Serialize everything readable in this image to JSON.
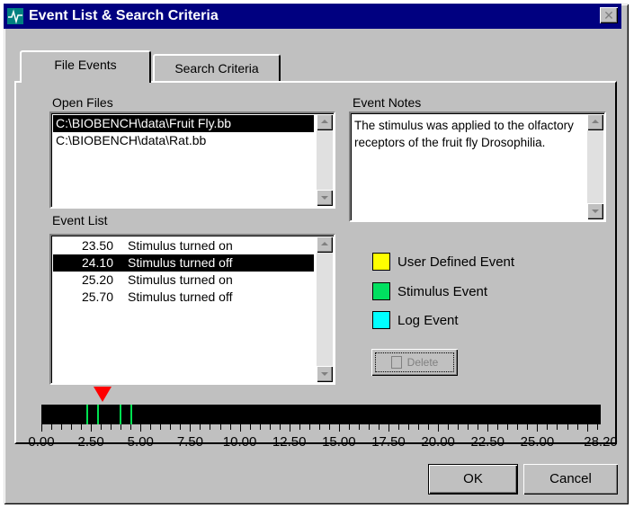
{
  "window": {
    "title": "Event List & Search Criteria"
  },
  "tabs": [
    {
      "label": "File Events",
      "active": true
    },
    {
      "label": "Search Criteria",
      "active": false
    }
  ],
  "open_files": {
    "label": "Open Files",
    "items": [
      "C:\\BIOBENCH\\data\\Fruit Fly.bb",
      "C:\\BIOBENCH\\data\\Rat.bb"
    ],
    "selected_index": 0
  },
  "event_notes": {
    "label": "Event Notes",
    "text": "The stimulus was applied to the olfactory receptors of the fruit fly Drosophilia."
  },
  "event_list": {
    "label": "Event List",
    "items": [
      {
        "time": "23.50",
        "desc": "Stimulus turned on"
      },
      {
        "time": "24.10",
        "desc": "Stimulus turned off"
      },
      {
        "time": "25.20",
        "desc": "Stimulus turned on"
      },
      {
        "time": "25.70",
        "desc": "Stimulus turned off"
      }
    ],
    "selected_index": 1
  },
  "legend": [
    {
      "label": "User Defined Event",
      "color": "#ffff00"
    },
    {
      "label": "Stimulus Event",
      "color": "#00e060"
    },
    {
      "label": "Log Event",
      "color": "#00ffff"
    }
  ],
  "delete_button": {
    "label": "Delete",
    "icon": "trash-icon",
    "enabled": false
  },
  "timeline": {
    "min": 0.0,
    "max": 28.2,
    "cursor_value": 3.1,
    "marker_values": [
      2.3,
      2.85,
      4.0,
      4.55
    ],
    "marker_color": "#00e050",
    "cursor_color": "#ff0000",
    "tick_labels": [
      "0.00",
      "2.50",
      "5.00",
      "7.50",
      "10.00",
      "12.50",
      "15.00",
      "17.50",
      "20.00",
      "22.50",
      "25.00",
      "28.20"
    ]
  },
  "buttons": {
    "ok_label": "OK",
    "cancel_label": "Cancel"
  }
}
